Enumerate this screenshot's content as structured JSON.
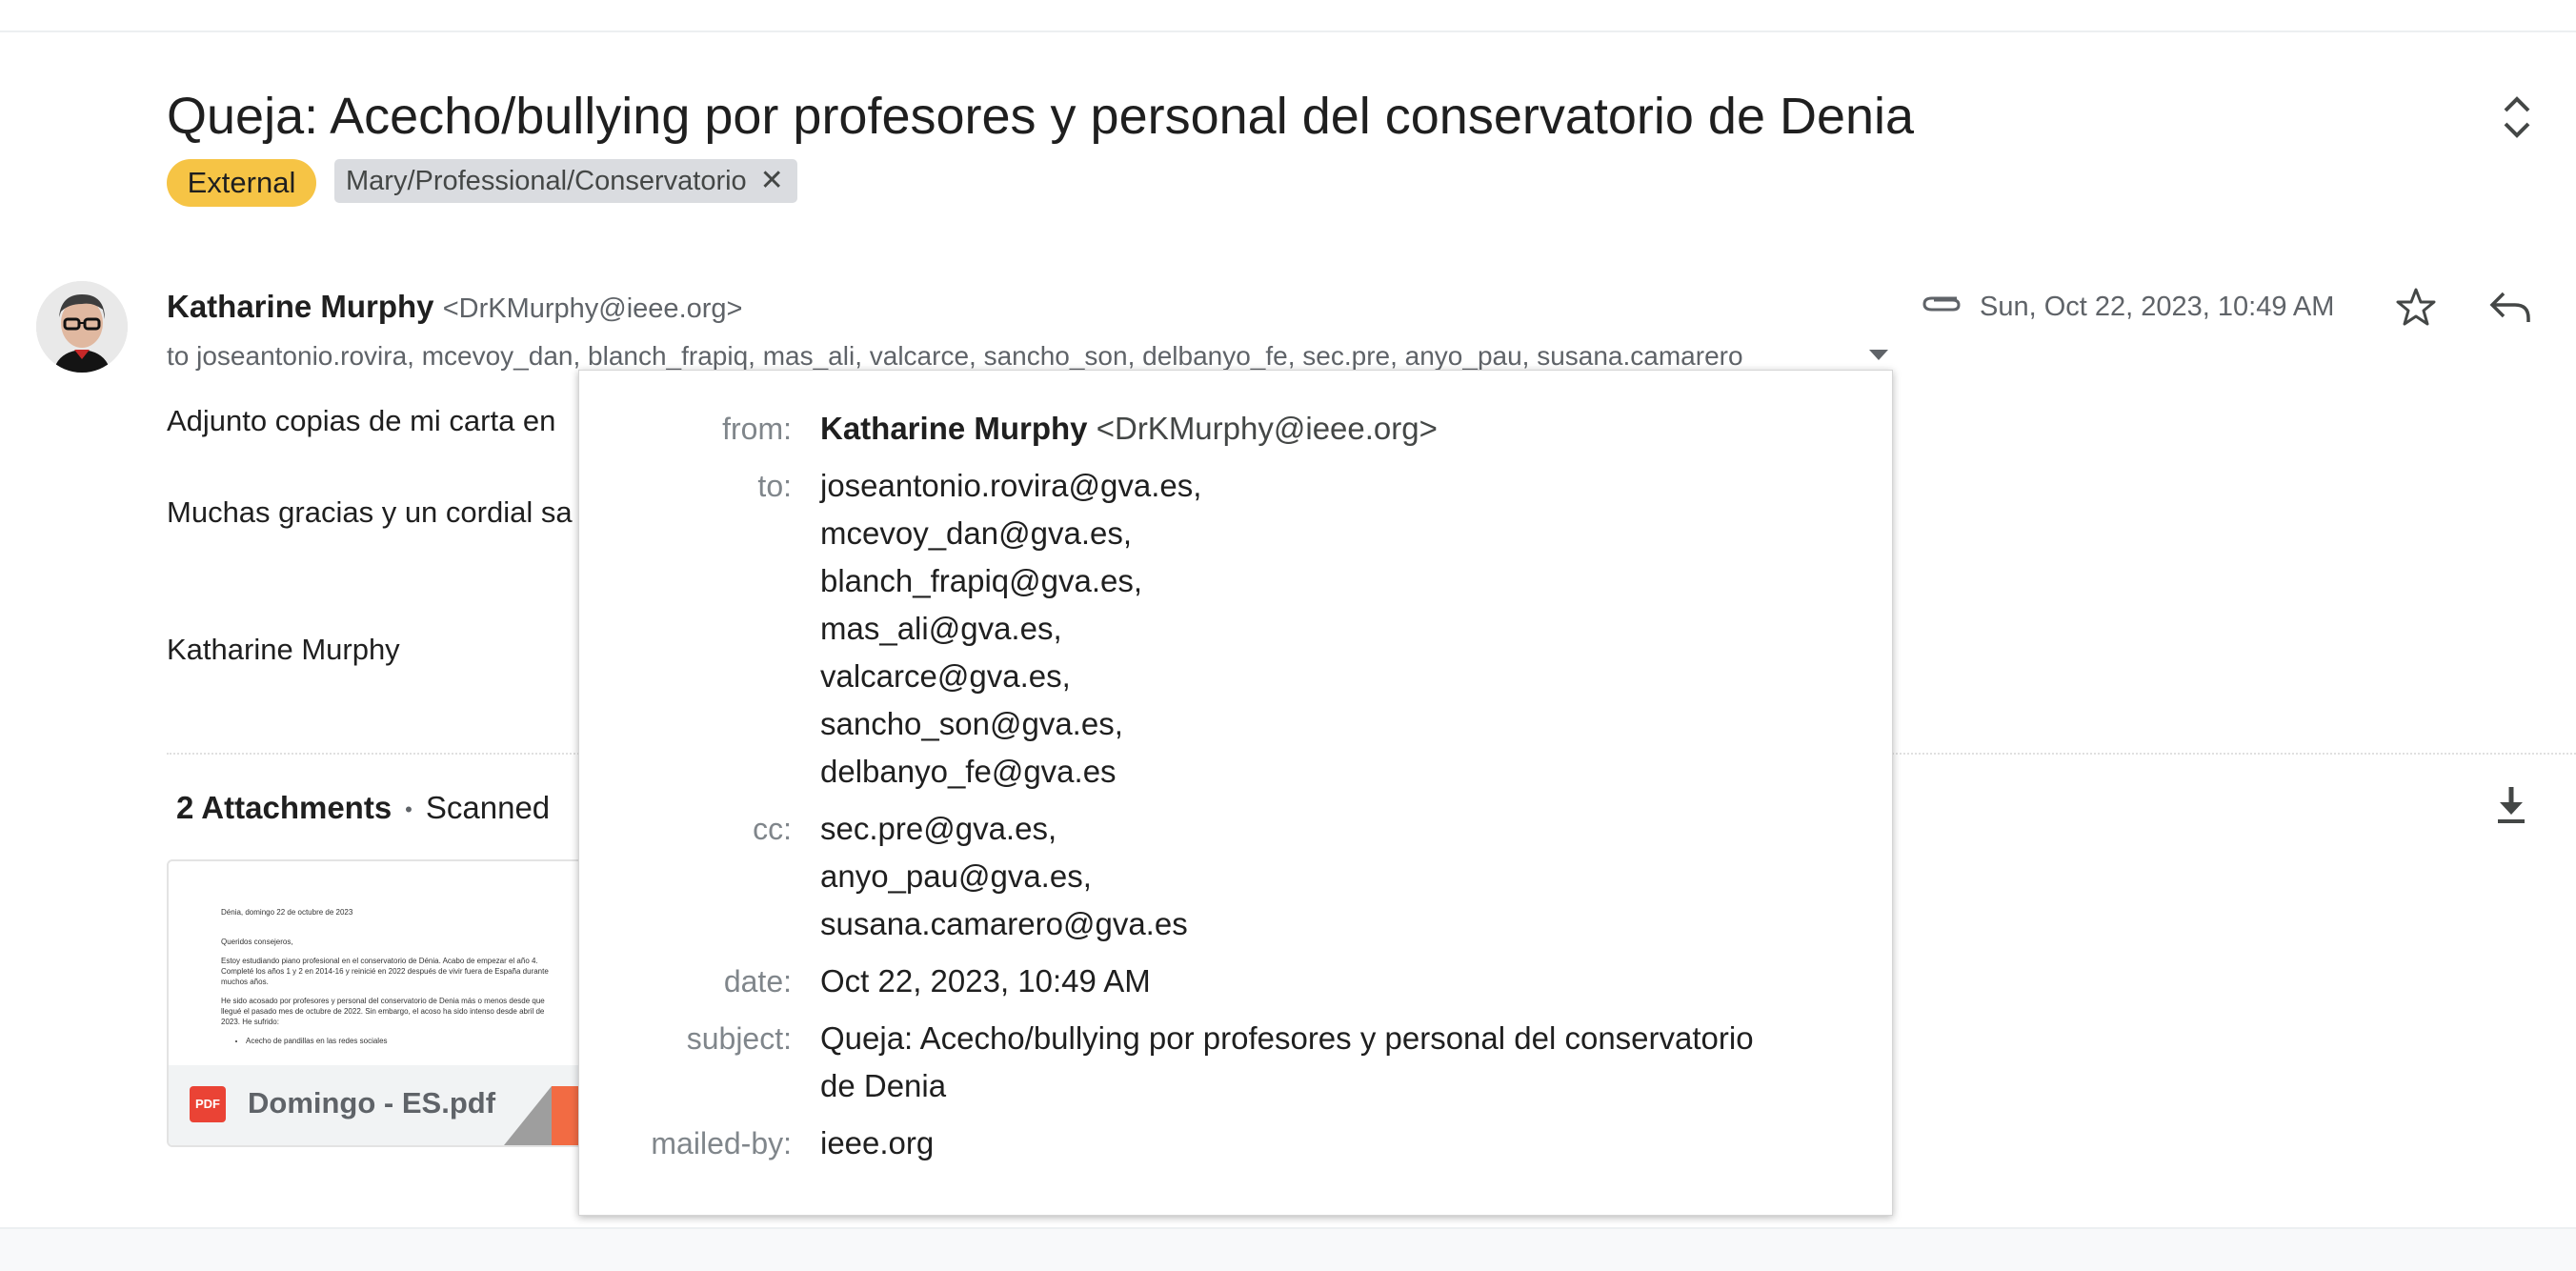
{
  "email": {
    "subject": "Queja: Acecho/bullying por profesores y personal del conservatorio de Denia",
    "labels": {
      "external": "External",
      "folder": "Mary/Professional/Conservatorio"
    },
    "sender_name": "Katharine Murphy",
    "sender_email": "<DrKMurphy@ieee.org>",
    "recipients_summary": "to joseantonio.rovira, mcevoy_dan, blanch_frapiq, mas_ali, valcarce, sancho_son, delbanyo_fe, sec.pre, anyo_pau, susana.camarero",
    "date": "Sun, Oct 22, 2023, 10:49 AM",
    "body": {
      "line1": "Adjunto copias de mi carta en",
      "line2": "Muchas gracias y un cordial sa",
      "signature": "Katharine Murphy"
    },
    "attachments": {
      "count_label": "2 Attachments",
      "scan_text": "Scanned",
      "file_name": "Domingo - ES.pdf",
      "file_type": "PDF",
      "preview": {
        "date_line": "Dénia, domingo 22 de octubre de 2023",
        "greeting": "Queridos consejeros,",
        "para1": "Estoy estudiando piano profesional en el conservatorio de Dénia. Acabo de empezar el año 4. Completé los años 1 y 2 en 2014-16 y reinicié en 2022 después de vivir fuera de España durante muchos años.",
        "para2": "He sido acosado por profesores y personal del conservatorio de Denia más o menos desde que llegué el pasado mes de octubre de 2022. Sin embargo, el acoso ha sido intenso desde abril de 2023. He sufrido:",
        "bullet1": "Acecho de pandillas en las redes sociales"
      }
    }
  },
  "details_popup": {
    "labels": {
      "from": "from:",
      "to": "to:",
      "cc": "cc:",
      "date": "date:",
      "subject": "subject:",
      "mailed_by": "mailed-by:"
    },
    "from_name": "Katharine Murphy",
    "from_email": "<DrKMurphy@ieee.org>",
    "to": [
      "joseantonio.rovira@gva.es,",
      "mcevoy_dan@gva.es,",
      "blanch_frapiq@gva.es,",
      "mas_ali@gva.es,",
      "valcarce@gva.es,",
      "sancho_son@gva.es,",
      "delbanyo_fe@gva.es"
    ],
    "cc": [
      "sec.pre@gva.es,",
      "anyo_pau@gva.es,",
      "susana.camarero@gva.es"
    ],
    "date": "Oct 22, 2023, 10:49 AM",
    "subject_line1": "Queja: Acecho/bullying por profesores y personal del conservatorio",
    "subject_line2": "de Denia",
    "mailed_by": "ieee.org"
  },
  "colors": {
    "external_badge": "#f6c445",
    "label_chip": "#dadce0",
    "pdf_red": "#ea4335"
  },
  "icons": [
    "expand-collapse-icon",
    "close-icon",
    "paperclip-icon",
    "star-icon",
    "reply-icon",
    "chevron-down-icon",
    "download-icon",
    "pdf-icon"
  ]
}
